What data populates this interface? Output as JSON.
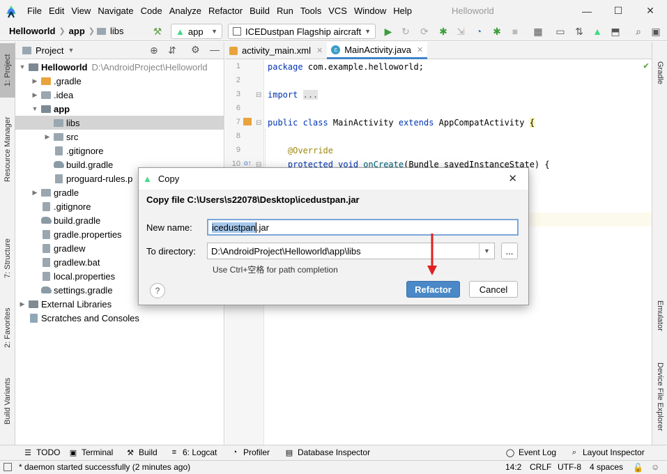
{
  "menubar": {
    "items": [
      "File",
      "Edit",
      "View",
      "Navigate",
      "Code",
      "Analyze",
      "Refactor",
      "Build",
      "Run",
      "Tools",
      "VCS",
      "Window",
      "Help"
    ],
    "window_title": "Helloworld",
    "minimize": "—",
    "maximize": "☐",
    "close": "✕"
  },
  "toolbar": {
    "breadcrumbs": [
      "Helloworld",
      "app",
      "libs"
    ],
    "module_combo": "app",
    "device_combo": "ICEDustpan Flagship aircraft"
  },
  "left_tabs": {
    "project": "1: Project",
    "resource_manager": "Resource Manager",
    "structure": "7: Structure",
    "favorites": "2: Favorites",
    "build_variants": "Build Variants"
  },
  "right_tabs": {
    "gradle": "Gradle",
    "emulator": "Emulator",
    "device_file_explorer": "Device File Explorer"
  },
  "project": {
    "header_title": "Project",
    "tree": [
      {
        "label": "Helloworld",
        "path": "D:\\AndroidProject\\Helloworld",
        "depth": 0,
        "expanded": true,
        "icon": "module-icon"
      },
      {
        "label": ".gradle",
        "depth": 1,
        "expanded": false,
        "icon": "folder-orange-icon"
      },
      {
        "label": ".idea",
        "depth": 1,
        "expanded": false,
        "icon": "folder-icon"
      },
      {
        "label": "app",
        "depth": 1,
        "expanded": true,
        "icon": "module-folder-icon"
      },
      {
        "label": "libs",
        "depth": 2,
        "selected": true,
        "icon": "folder-icon"
      },
      {
        "label": "src",
        "depth": 2,
        "expanded": false,
        "icon": "folder-icon"
      },
      {
        "label": ".gitignore",
        "depth": 2,
        "icon": "file-icon"
      },
      {
        "label": "build.gradle",
        "depth": 2,
        "icon": "gradle-icon"
      },
      {
        "label": "proguard-rules.p",
        "depth": 2,
        "icon": "file-icon"
      },
      {
        "label": "gradle",
        "depth": 1,
        "expanded": false,
        "icon": "folder-icon"
      },
      {
        "label": ".gitignore",
        "depth": 1,
        "icon": "file-icon"
      },
      {
        "label": "build.gradle",
        "depth": 1,
        "icon": "gradle-icon"
      },
      {
        "label": "gradle.properties",
        "depth": 1,
        "icon": "file-icon"
      },
      {
        "label": "gradlew",
        "depth": 1,
        "icon": "file-icon"
      },
      {
        "label": "gradlew.bat",
        "depth": 1,
        "icon": "file-icon"
      },
      {
        "label": "local.properties",
        "depth": 1,
        "icon": "file-icon"
      },
      {
        "label": "settings.gradle",
        "depth": 1,
        "icon": "gradle-icon"
      },
      {
        "label": "External Libraries",
        "depth": 0,
        "expanded": false,
        "icon": "library-icon"
      },
      {
        "label": "Scratches and Consoles",
        "depth": 0,
        "icon": "scratches-icon"
      }
    ]
  },
  "editor": {
    "tabs": [
      {
        "label": "activity_main.xml",
        "active": false
      },
      {
        "label": "MainActivity.java",
        "active": true
      }
    ],
    "line_numbers": [
      "1",
      "2",
      "3",
      "6",
      "7",
      "8",
      "9",
      "10"
    ]
  },
  "dialog": {
    "title": "Copy",
    "heading": "Copy file C:\\Users\\s22078\\Desktop\\icedustpan.jar",
    "new_name_label": "New name:",
    "new_name_value": "icedustpan.jar",
    "new_name_selected": "icedustpan",
    "new_name_rest": ".jar",
    "to_directory_label": "To directory:",
    "to_directory_value": "D:\\AndroidProject\\Helloworld\\app\\libs",
    "hint": "Use Ctrl+空格 for path completion",
    "browse_label": "...",
    "help_label": "?",
    "refactor_label": "Refactor",
    "cancel_label": "Cancel"
  },
  "bottom_tools": {
    "todo": "TODO",
    "terminal": "Terminal",
    "build": "Build",
    "logcat": "6: Logcat",
    "profiler": "Profiler",
    "database_inspector": "Database Inspector",
    "event_log": "Event Log",
    "layout_inspector": "Layout Inspector"
  },
  "status": {
    "message": "* daemon started successfully (2 minutes ago)",
    "position": "14:2",
    "line_sep": "CRLF",
    "encoding": "UTF-8",
    "indent": "4 spaces"
  },
  "colors": {
    "accent": "#4083c9",
    "refactor_button": "#4a88c7",
    "red_arrow": "#e02020",
    "android_green": "#3ddc84"
  }
}
